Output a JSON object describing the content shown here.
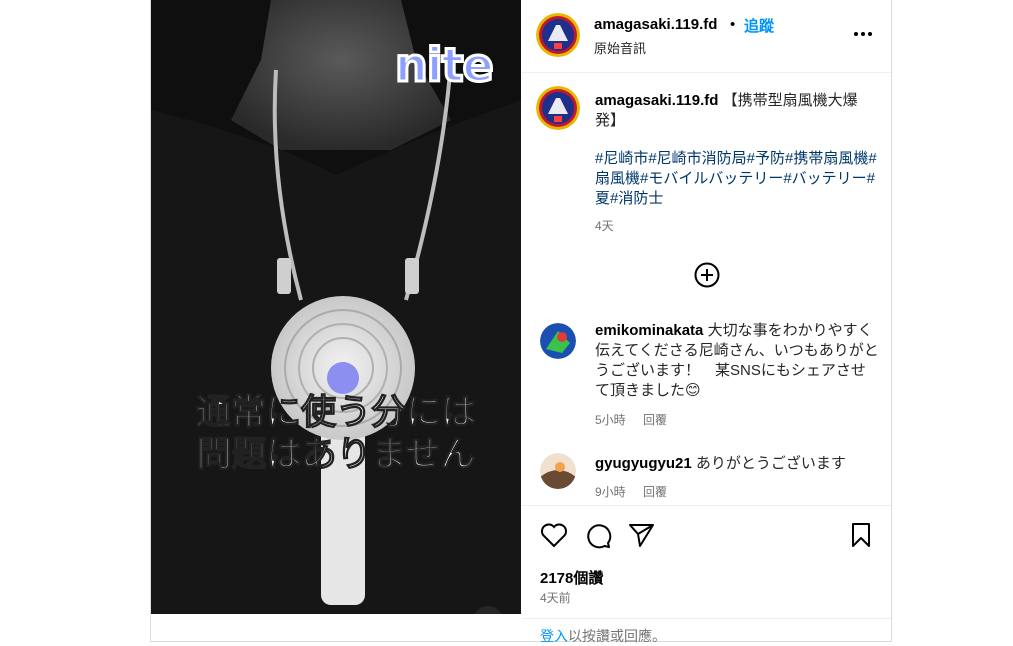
{
  "video": {
    "overlay_logo": "nite",
    "subtitle": "通常に使う分には\n問題はありません",
    "mute_icon": "speaker-muted-icon"
  },
  "post": {
    "username": "amagasaki.119.fd",
    "separator": "•",
    "follow_label": "追蹤",
    "audio_label": "原始音訊",
    "more_icon": "more-options-icon"
  },
  "caption": {
    "username": "amagasaki.119.fd",
    "text": "【携帯型扇風機大爆発】",
    "hashtags": "#尼崎市#尼崎市消防局#予防#携帯扇風機#扇風機#モバイルバッテリー#バッテリー#夏#消防士",
    "age": "4天"
  },
  "load_more_icon": "add-circle-icon",
  "comments": [
    {
      "username": "emikominakata",
      "text": "大切な事をわかりやすく伝えてくださる尼崎さん、いつもありがとうございます！　某SNSにもシェアさせて頂きました😊",
      "age": "5小時",
      "reply_label": "回覆"
    },
    {
      "username": "gyugyugyu21",
      "text": "ありがとうございます",
      "age": "9小時",
      "reply_label": "回覆"
    }
  ],
  "actions": {
    "likes": "2178個讚",
    "time": "4天前",
    "login_link": "登入",
    "login_rest": "以按讚或回應。"
  },
  "colors": {
    "accent": "#0095f6",
    "hashtag": "#00376b",
    "muted": "#737373"
  }
}
